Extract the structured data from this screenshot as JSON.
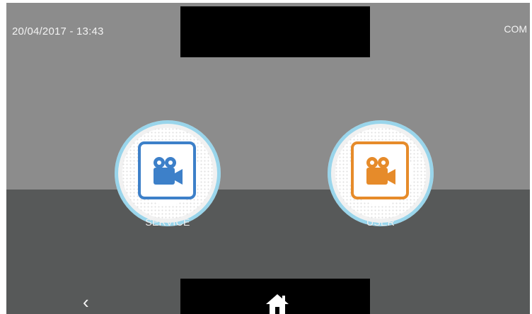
{
  "status": {
    "datetime": "20/04/2017 - 13:43",
    "mode": "COM"
  },
  "menu": {
    "items": [
      {
        "label": "SERVICE",
        "icon": "video-camera-icon",
        "color": "#3d80c9"
      },
      {
        "label": "USER",
        "icon": "video-camera-icon",
        "color": "#e68b2a"
      }
    ]
  },
  "nav": {
    "back_icon": "chevron-left-icon",
    "home_icon": "home-icon"
  }
}
